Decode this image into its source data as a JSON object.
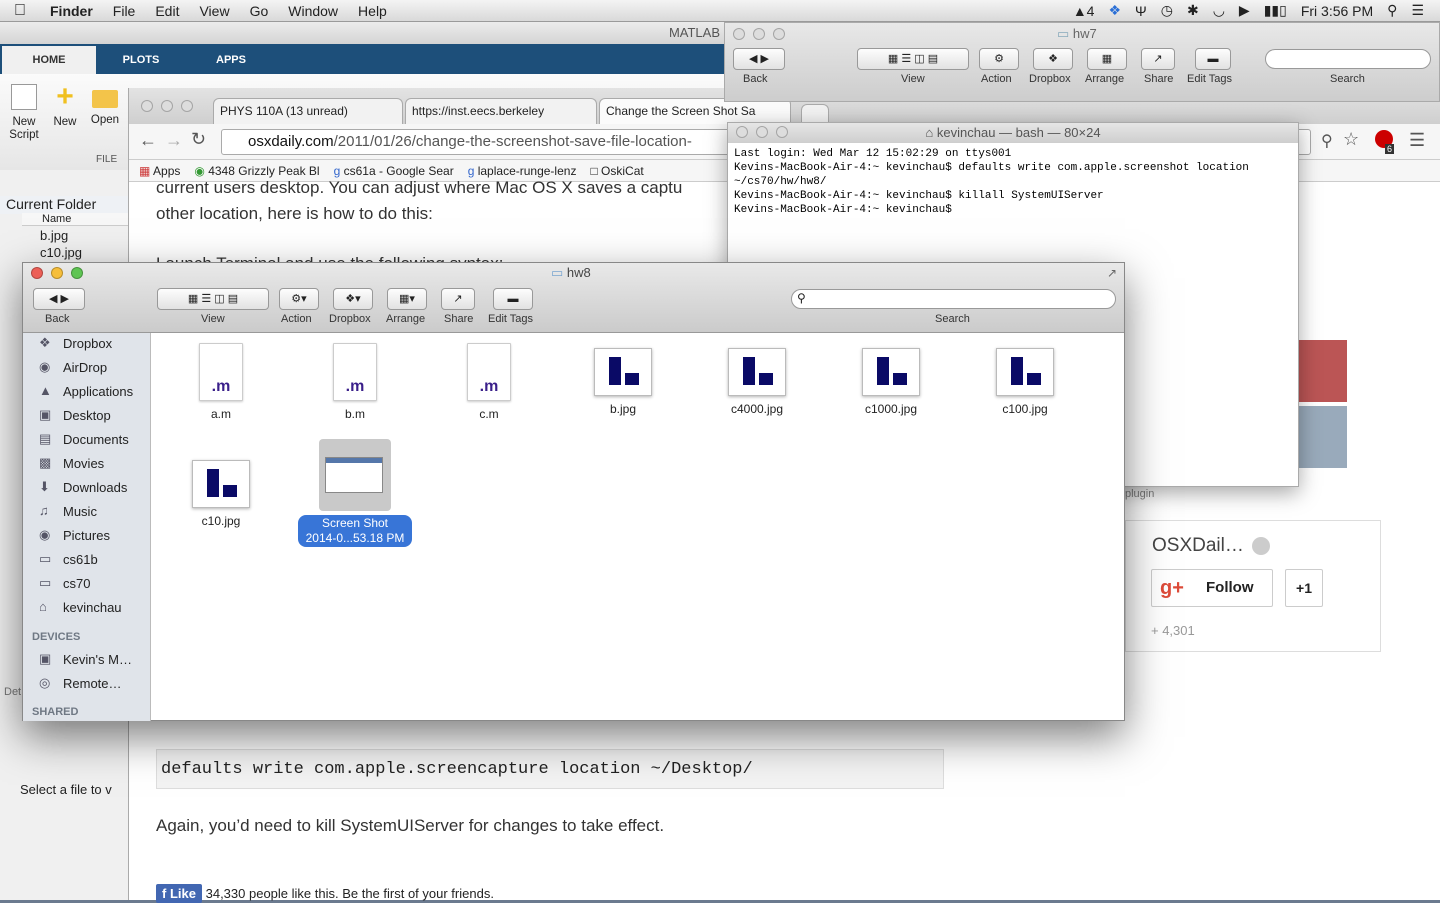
{
  "menubar": {
    "app_name": "Finder",
    "items": [
      "File",
      "Edit",
      "View",
      "Go",
      "Window",
      "Help"
    ],
    "status_count": "4",
    "clock": "Fri 3:56 PM"
  },
  "matlab": {
    "title": "MATLAB",
    "tabs": [
      "HOME",
      "PLOTS",
      "APPS"
    ],
    "ribbon": {
      "new_script": "New\nScript",
      "new": "New",
      "open": "Open",
      "section": "FILE"
    },
    "current_folder": "Current Folder",
    "name_col": "Name",
    "files": [
      "b.jpg",
      "c10.jpg"
    ],
    "status": "Select a file to v",
    "details_label": "Det"
  },
  "chrome": {
    "tabs": [
      "PHYS 110A (13 unread)",
      "https://inst.eecs.berkeley",
      "Change the Screen Shot Sa"
    ],
    "url_host": "osxdaily.com",
    "url_path": "/2011/01/26/change-the-screenshot-save-file-location-",
    "bookmarks": [
      "Apps",
      "4348 Grizzly Peak Bl",
      "cs61a - Google Sear",
      "laplace-runge-lenz",
      "OskiCat"
    ],
    "page": {
      "line1": "current users desktop. You can adjust where Mac OS X saves a captu",
      "line2": "other location, here is how to do this:",
      "line3": "Launch Terminal and use the following syntax:",
      "code": "defaults write com.apple.screencapture location ~/Desktop/",
      "para": "Again, you’d need to kill SystemUIServer for changes to take effect.",
      "like_btn": "Like",
      "like_text": "34,330 people like this. Be the first of your friends."
    },
    "gplus": {
      "title": "OSXDail…",
      "follow": "Follow",
      "plusone": "+1",
      "count": "+ 4,301"
    },
    "plugin_label": "plugin",
    "badge_count": "6"
  },
  "hw7": {
    "title": "hw7",
    "labels": [
      "Back",
      "View",
      "Action",
      "Dropbox",
      "Arrange",
      "Share",
      "Edit Tags",
      "Search"
    ]
  },
  "terminal": {
    "title": "kevinchau — bash — 80×24",
    "lines": "Last login: Wed Mar 12 15:02:29 on ttys001\nKevins-MacBook-Air-4:~ kevinchau$ defaults write com.apple.screenshot location ~/cs70/hw/hw8/\nKevins-MacBook-Air-4:~ kevinchau$ killall SystemUIServer\nKevins-MacBook-Air-4:~ kevinchau$ "
  },
  "finder": {
    "title": "hw8",
    "toolbar": {
      "back": "Back",
      "view": "View",
      "action": "Action",
      "dropbox": "Dropbox",
      "arrange": "Arrange",
      "share": "Share",
      "edit_tags": "Edit Tags",
      "search": "Search"
    },
    "sidebar": {
      "favorites": [
        "Dropbox",
        "AirDrop",
        "Applications",
        "Desktop",
        "Documents",
        "Movies",
        "Downloads",
        "Music",
        "Pictures",
        "cs61b",
        "cs70",
        "kevinchau"
      ],
      "devices_header": "DEVICES",
      "devices": [
        "Kevin's M…",
        "Remote…"
      ],
      "shared_header": "SHARED"
    },
    "files": [
      {
        "name": "a.m",
        "ext": ".m"
      },
      {
        "name": "b.m",
        "ext": ".m"
      },
      {
        "name": "c.m",
        "ext": ".m"
      },
      {
        "name": "b.jpg"
      },
      {
        "name": "c4000.jpg"
      },
      {
        "name": "c1000.jpg"
      },
      {
        "name": "c100.jpg"
      },
      {
        "name": "c10.jpg"
      }
    ],
    "selected": {
      "line1": "Screen Shot",
      "line2": "2014-0...53.18 PM"
    }
  }
}
